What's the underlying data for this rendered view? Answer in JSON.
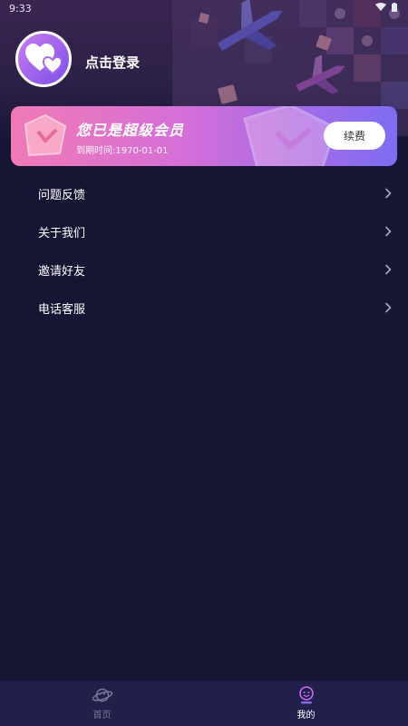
{
  "status_bar": {
    "time": "9:33"
  },
  "profile": {
    "login_text": "点击登录"
  },
  "vip": {
    "title": "您已是超级会员",
    "expiry": "到期时间:1970-01-01",
    "renew_label": "续费"
  },
  "menu": {
    "items": [
      {
        "label": "问题反馈"
      },
      {
        "label": "关于我们"
      },
      {
        "label": "邀请好友"
      },
      {
        "label": "电话客服"
      }
    ]
  },
  "tabs": [
    {
      "label": "首页",
      "icon": "planet-icon"
    },
    {
      "label": "我的",
      "icon": "profile-icon",
      "active": true
    }
  ],
  "colors": {
    "background": "#161533",
    "tab_bar": "#22204a",
    "accent_pink": "#f07ab6",
    "accent_purple": "#7f6cf2"
  }
}
